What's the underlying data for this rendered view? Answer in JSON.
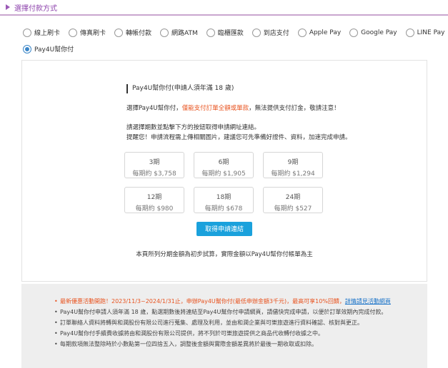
{
  "section": {
    "title": "選擇付款方式"
  },
  "payment_options": [
    {
      "label": "線上刷卡",
      "checked": false
    },
    {
      "label": "傳真刷卡",
      "checked": false
    },
    {
      "label": "轉帳付款",
      "checked": false
    },
    {
      "label": "網路ATM",
      "checked": false
    },
    {
      "label": "臨櫃匯款",
      "checked": false
    },
    {
      "label": "到店支付",
      "checked": false
    },
    {
      "label": "Apple Pay",
      "checked": false
    },
    {
      "label": "Google Pay",
      "checked": false
    },
    {
      "label": "LINE Pay",
      "checked": false
    },
    {
      "label": "Pay4U幫你付",
      "checked": true
    }
  ],
  "panel": {
    "heading": "Pay4U幫你付(申請人須年滿 18 歲)",
    "line1_prefix": "選擇Pay4U幫你付，",
    "line1_warn": "僅能支付訂單全額或單款",
    "line1_suffix": "，無法提供支付訂金，敬請注意！",
    "line2": "請選擇期數並點擊下方的按鈕取得申請網址連結。",
    "line3": "提醒您！申請流程需上傳相關圖片，建議您可先準備好證件、資料，加速完成申請。",
    "plans": [
      {
        "term": "3期",
        "amount": "每期約 $3,758"
      },
      {
        "term": "6期",
        "amount": "每期約 $1,905"
      },
      {
        "term": "9期",
        "amount": "每期約 $1,294"
      },
      {
        "term": "12期",
        "amount": "每期約 $980"
      },
      {
        "term": "18期",
        "amount": "每期約 $678"
      },
      {
        "term": "24期",
        "amount": "每期約 $527"
      }
    ],
    "apply_button": "取得申請連結",
    "note": "本頁所列分期金額為初步試算，實際金額以Pay4U幫你付帳單為主"
  },
  "info": {
    "promo_text": "最新優惠活動開跑！2023/11/3~2024/1/31止，申辦Pay4U幫你付(最低申辦金額3千元)，最高可享10%回饋，",
    "promo_link": "詳情請見活動網頁",
    "item2": "Pay4U幫你付申請人須年滿 18 歲，點選期數後將連結至Pay4U幫你付申請網頁，請儘快完成申請，以便於訂單效期內完成付款。",
    "item3": "訂單聯絡人資料將轉與和潤股份有限公司進行蒐集、處理及利用，並由和潤企業與可樂旅遊進行資料確認、核對與更正。",
    "item4": "Pay4U幫你付手續費收據將由和潤股份有限公司提供，將不列於可樂旅遊提供之商品代收轉付收據之中。",
    "item5": "每期款項無法整除時於小數點第一位四捨五入，調整後金額與實際金額差異將於最後一期收取或扣除。"
  }
}
